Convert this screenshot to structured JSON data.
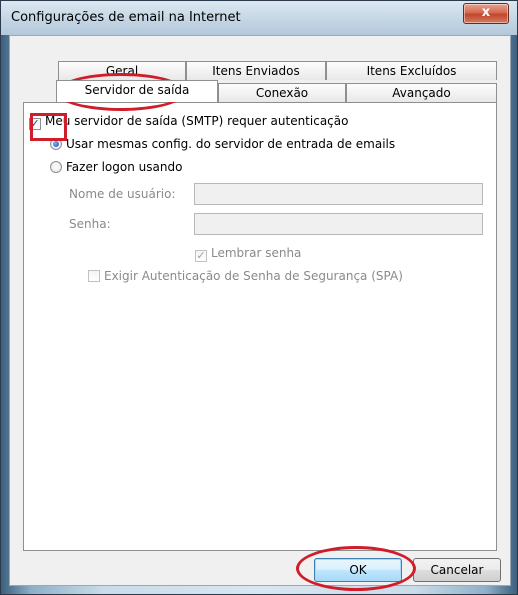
{
  "window": {
    "title": "Configurações de email na Internet",
    "close_label": "x"
  },
  "tabs": {
    "back_row": [
      "Geral",
      "Itens Enviados",
      "Itens Excluídos"
    ],
    "front_row": [
      "Servidor de saída",
      "Conexão",
      "Avançado"
    ],
    "active": "Servidor de saída"
  },
  "smtp_auth": {
    "label": "Meu servidor de saída (SMTP) requer autenticação",
    "checked": true
  },
  "radio_same": {
    "label": "Usar mesmas config. do servidor de entrada de emails",
    "selected": true
  },
  "radio_logon": {
    "label": "Fazer logon usando",
    "selected": false
  },
  "username": {
    "label": "Nome de usuário:",
    "value": ""
  },
  "password": {
    "label": "Senha:",
    "value": ""
  },
  "remember_password": {
    "label": "Lembrar senha",
    "checked": true,
    "enabled": false
  },
  "spa": {
    "label": "Exigir Autenticação de Senha de Segurança (SPA)",
    "checked": false,
    "enabled": false
  },
  "buttons": {
    "ok": "OK",
    "cancel": "Cancelar"
  },
  "colors": {
    "annotation": "#d11c2a"
  },
  "icons": {
    "check": "✓",
    "close": "close-icon"
  }
}
